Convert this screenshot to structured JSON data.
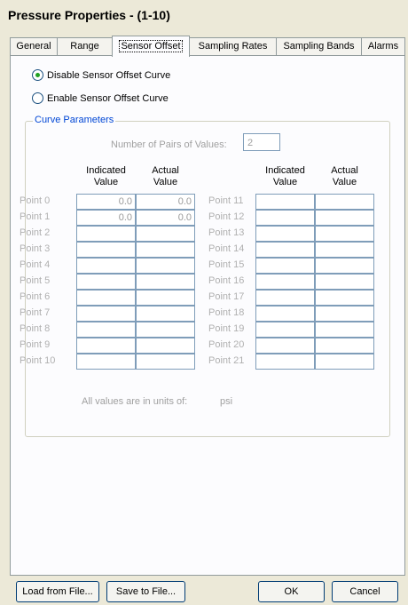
{
  "window": {
    "title": "Pressure Properties -  (1-10)"
  },
  "tabs": [
    {
      "label": "General"
    },
    {
      "label": "Range"
    },
    {
      "label": "Sensor Offset"
    },
    {
      "label": "Sampling Rates"
    },
    {
      "label": "Sampling Bands"
    },
    {
      "label": "Alarms"
    }
  ],
  "options": {
    "disable_label": "Disable Sensor Offset Curve",
    "enable_label": "Enable Sensor Offset Curve",
    "selected": "disable"
  },
  "curve": {
    "group_title": "Curve Parameters",
    "pairs_label": "Number of Pairs of Values:",
    "pairs_value": "2",
    "headers": {
      "indicated_line1": "Indicated",
      "indicated_line2": "Value",
      "actual_line1": "Actual",
      "actual_line2": "Value"
    },
    "left_points": [
      {
        "label": "Point 0",
        "indicated": "0.0",
        "actual": "0.0"
      },
      {
        "label": "Point 1",
        "indicated": "0.0",
        "actual": "0.0"
      },
      {
        "label": "Point 2",
        "indicated": "",
        "actual": ""
      },
      {
        "label": "Point 3",
        "indicated": "",
        "actual": ""
      },
      {
        "label": "Point 4",
        "indicated": "",
        "actual": ""
      },
      {
        "label": "Point 5",
        "indicated": "",
        "actual": ""
      },
      {
        "label": "Point 6",
        "indicated": "",
        "actual": ""
      },
      {
        "label": "Point 7",
        "indicated": "",
        "actual": ""
      },
      {
        "label": "Point 8",
        "indicated": "",
        "actual": ""
      },
      {
        "label": "Point 9",
        "indicated": "",
        "actual": ""
      },
      {
        "label": "Point 10",
        "indicated": "",
        "actual": ""
      }
    ],
    "right_points": [
      {
        "label": "Point 11",
        "indicated": "",
        "actual": ""
      },
      {
        "label": "Point 12",
        "indicated": "",
        "actual": ""
      },
      {
        "label": "Point 13",
        "indicated": "",
        "actual": ""
      },
      {
        "label": "Point 14",
        "indicated": "",
        "actual": ""
      },
      {
        "label": "Point 15",
        "indicated": "",
        "actual": ""
      },
      {
        "label": "Point 16",
        "indicated": "",
        "actual": ""
      },
      {
        "label": "Point 17",
        "indicated": "",
        "actual": ""
      },
      {
        "label": "Point 18",
        "indicated": "",
        "actual": ""
      },
      {
        "label": "Point 19",
        "indicated": "",
        "actual": ""
      },
      {
        "label": "Point 20",
        "indicated": "",
        "actual": ""
      },
      {
        "label": "Point 21",
        "indicated": "",
        "actual": ""
      }
    ],
    "units_label": "All values are in units of:",
    "units_value": "psi"
  },
  "buttons": {
    "load": "Load from File...",
    "save": "Save to File...",
    "ok": "OK",
    "cancel": "Cancel"
  }
}
